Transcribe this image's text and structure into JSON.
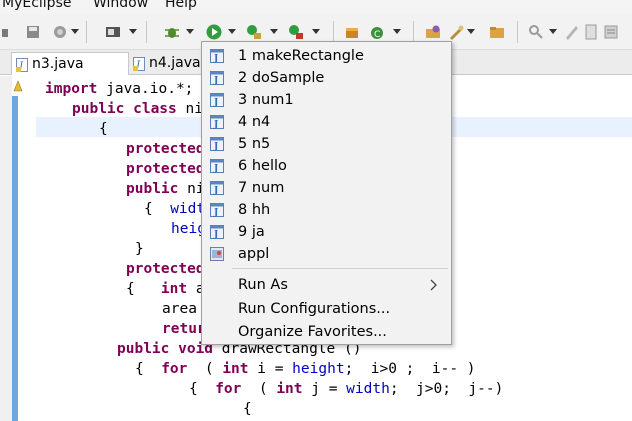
{
  "menubar": {
    "items": [
      "MyEclipse",
      "Window",
      "Help"
    ]
  },
  "tabs": [
    {
      "label": "n3.java"
    },
    {
      "label": "n4.java"
    }
  ],
  "code": [
    {
      "t": [
        [
          "kw",
          "import "
        ],
        [
          "",
          "java.io.*;"
        ]
      ]
    },
    {
      "t": [
        [
          "kw",
          "public class "
        ],
        [
          "",
          "ni"
        ]
      ]
    },
    {
      "t": [
        [
          "",
          "{"
        ]
      ]
    },
    {
      "t": [
        [
          "kw",
          "protected"
        ]
      ]
    },
    {
      "t": [
        [
          "kw",
          "protected"
        ]
      ]
    },
    {
      "t": [
        [
          "kw",
          "public "
        ],
        [
          "",
          "ni"
        ]
      ]
    },
    {
      "t": [
        [
          "",
          "{  "
        ],
        [
          "fld",
          "widt"
        ]
      ]
    },
    {
      "t": [
        [
          "fld",
          "heig"
        ]
      ]
    },
    {
      "t": [
        [
          "",
          "}"
        ]
      ]
    },
    {
      "t": [
        [
          "kw",
          "protected"
        ]
      ]
    },
    {
      "t": [
        [
          "",
          "{   "
        ],
        [
          "kw",
          "int "
        ],
        [
          "",
          "a"
        ]
      ]
    },
    {
      "t": [
        [
          "",
          "area"
        ]
      ]
    },
    {
      "t": [
        [
          "kw",
          "retur"
        ]
      ]
    },
    {
      "t": [
        [
          "kw",
          "public void "
        ],
        [
          "",
          "drawRectangle ()"
        ]
      ]
    },
    {
      "t": [
        [
          "",
          "{  "
        ],
        [
          "kw",
          "for  "
        ],
        [
          "",
          "( "
        ],
        [
          "kw",
          "int "
        ],
        [
          "",
          "i = "
        ],
        [
          "fld",
          "height"
        ],
        [
          "",
          ";  i>0 ;  i-- )"
        ]
      ]
    },
    {
      "t": [
        [
          "",
          "{  "
        ],
        [
          "kw",
          "for  "
        ],
        [
          "",
          "( "
        ],
        [
          "kw",
          "int "
        ],
        [
          "",
          "j = "
        ],
        [
          "fld",
          "width"
        ],
        [
          "",
          ";  j>0;  j--)"
        ]
      ]
    },
    {
      "t": [
        [
          "",
          "{"
        ]
      ]
    }
  ],
  "popup": {
    "favorites": [
      "1 makeRectangle",
      "2 doSample",
      "3 num1",
      "4 n4",
      "5 n5",
      "6 hello",
      "7 num",
      "8 hh",
      "9 ja",
      "appl"
    ],
    "actions": [
      "Run As",
      "Run Configurations...",
      "Organize Favorites..."
    ]
  },
  "colors": {
    "keyword": "#7f0055",
    "field": "#0000c0",
    "java_icon": "#2f6fb5",
    "run_green": "#2e9e3f"
  }
}
